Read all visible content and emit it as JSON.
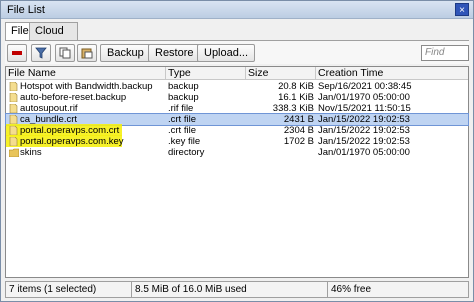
{
  "window": {
    "title": "File List",
    "close_symbol": "×"
  },
  "tabs": [
    {
      "label": "File"
    },
    {
      "label": "Cloud Backup"
    }
  ],
  "toolbar": {
    "backup_label": "Backup",
    "restore_label": "Restore",
    "upload_label": "Upload...",
    "find_placeholder": "Find"
  },
  "columns": [
    "File Name",
    "Type",
    "Size",
    "Creation Time"
  ],
  "rows": [
    {
      "name": "Hotspot with Bandwidth.backup",
      "type": "backup",
      "size": "20.8 KiB",
      "created": "Sep/16/2021 00:38:45",
      "icon": "file-icon",
      "selected": false,
      "highlight": false
    },
    {
      "name": "auto-before-reset.backup",
      "type": "backup",
      "size": "16.1 KiB",
      "created": "Jan/01/1970 05:00:00",
      "icon": "file-icon",
      "selected": false,
      "highlight": false
    },
    {
      "name": "autosupout.rif",
      "type": ".rif file",
      "size": "338.3 KiB",
      "created": "Nov/15/2021 11:50:15",
      "icon": "file-icon",
      "selected": false,
      "highlight": false
    },
    {
      "name": "ca_bundle.crt",
      "type": ".crt file",
      "size": "2431 B",
      "created": "Jan/15/2022 19:02:53",
      "icon": "file-icon",
      "selected": true,
      "highlight": true
    },
    {
      "name": "portal.operavps.com.crt",
      "type": ".crt file",
      "size": "2304 B",
      "created": "Jan/15/2022 19:02:53",
      "icon": "file-icon",
      "selected": false,
      "highlight": true
    },
    {
      "name": "portal.operavps.com.key",
      "type": ".key file",
      "size": "1702 B",
      "created": "Jan/15/2022 19:02:53",
      "icon": "file-icon",
      "selected": false,
      "highlight": true
    },
    {
      "name": "skins",
      "type": "directory",
      "size": "",
      "created": "Jan/01/1970 05:00:00",
      "icon": "folder-icon",
      "selected": false,
      "highlight": false
    }
  ],
  "status": {
    "items": "7 items (1 selected)",
    "usage": "8.5 MiB of 16.0 MiB used",
    "free": "46% free"
  },
  "colors": {
    "selection": "#bfd4f2",
    "highlight": "#f5ef12",
    "close_button": "#2f55b8"
  }
}
